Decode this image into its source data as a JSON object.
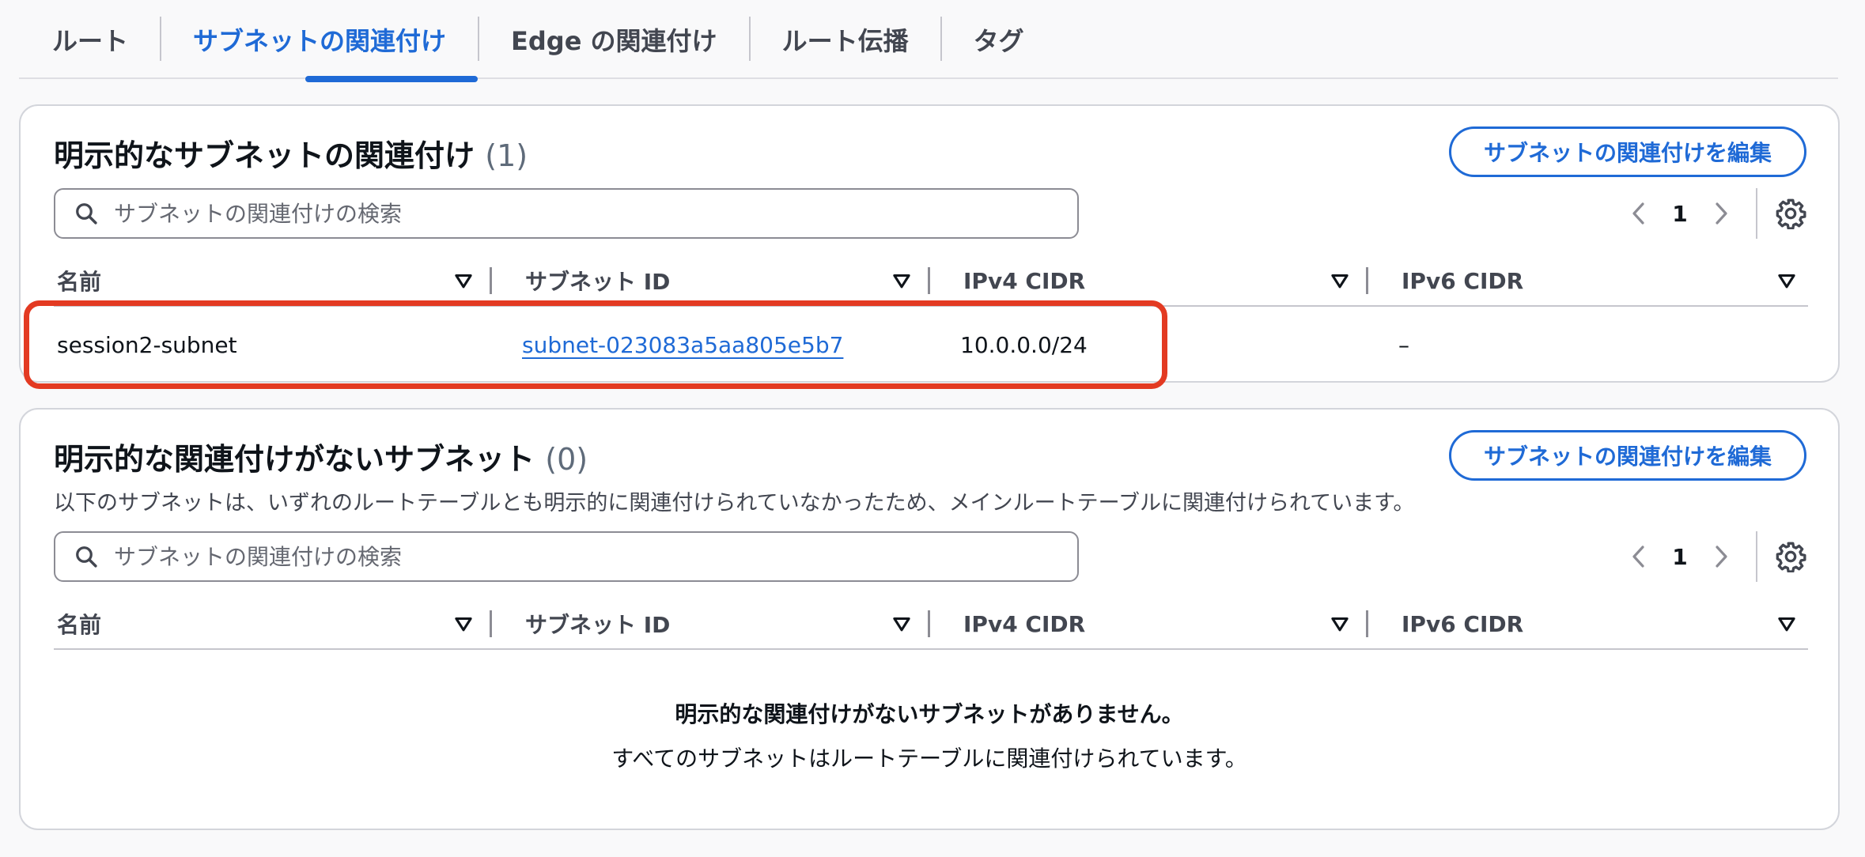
{
  "tabs": [
    {
      "label": "ルート"
    },
    {
      "label": "サブネットの関連付け",
      "active": true
    },
    {
      "label": "Edge の関連付け"
    },
    {
      "label": "ルート伝播"
    },
    {
      "label": "タグ"
    }
  ],
  "explicit": {
    "title": "明示的なサブネットの関連付け",
    "count": "(1)",
    "edit_label": "サブネットの関連付けを編集",
    "search_placeholder": "サブネットの関連付けの検索",
    "page": "1",
    "columns": [
      "名前",
      "サブネット ID",
      "IPv4 CIDR",
      "IPv6 CIDR"
    ],
    "rows": [
      {
        "name": "session2-subnet",
        "subnet_id": "subnet-023083a5aa805e5b7",
        "ipv4": "10.0.0.0/24",
        "ipv6": "–"
      }
    ]
  },
  "implicit": {
    "title": "明示的な関連付けがないサブネット",
    "count": "(0)",
    "description": "以下のサブネットは、いずれのルートテーブルとも明示的に関連付けられていなかったため、メインルートテーブルに関連付けられています。",
    "edit_label": "サブネットの関連付けを編集",
    "search_placeholder": "サブネットの関連付けの検索",
    "page": "1",
    "columns": [
      "名前",
      "サブネット ID",
      "IPv4 CIDR",
      "IPv6 CIDR"
    ],
    "empty_title": "明示的な関連付けがないサブネットがありません。",
    "empty_message": "すべてのサブネットはルートテーブルに関連付けられています。"
  },
  "colors": {
    "accent": "#1f6ad6",
    "highlight": "#e33a22"
  }
}
